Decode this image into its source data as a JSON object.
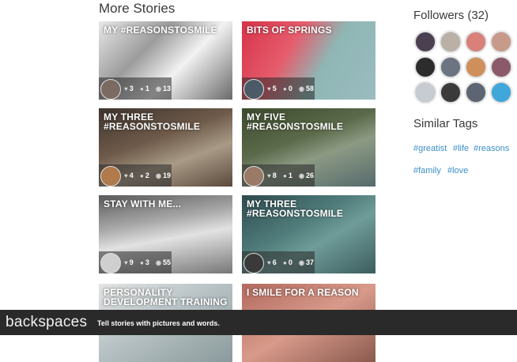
{
  "more_stories": {
    "title": "More Stories",
    "cards": [
      {
        "title": "MY #REASONSTOSMILE",
        "likes": "3",
        "comments": "1",
        "views": "13",
        "bg": "linear-gradient(135deg,#e8e8e8 0%,#9c9c9c 35%,#f2f2f2 60%,#6a6a6a 100%)",
        "avatar": "#7a6a62"
      },
      {
        "title": "BITS OF SPRINGS",
        "likes": "5",
        "comments": "0",
        "views": "58",
        "bg": "linear-gradient(120deg,#d6334a 0%,#e65c6c 35%,#8fb6b4 60%,#9bbcc0 100%)",
        "avatar": "#4b5a66"
      },
      {
        "title": "MY THREE #REASONSTOSMILE",
        "likes": "4",
        "comments": "2",
        "views": "19",
        "bg": "linear-gradient(160deg,#3e342e 0%,#6e5a4a 40%,#a89a86 65%,#5a4a3c 100%)",
        "avatar": "#b07a4a"
      },
      {
        "title": "MY FIVE #REASONSTOSMILE",
        "likes": "8",
        "comments": "1",
        "views": "26",
        "bg": "linear-gradient(160deg,#3c4a2e 0%,#5b6a4a 40%,#8c9a84 60%,#556a6c 100%)",
        "avatar": "#9a7a66"
      },
      {
        "title": "STAY WITH ME...",
        "likes": "9",
        "comments": "3",
        "views": "55",
        "bg": "linear-gradient(170deg,#5a5a5a 0%,#a8a8a8 35%,#e2e2e2 55%,#777777 100%)",
        "avatar": "#cfcfcf"
      },
      {
        "title": "MY THREE #REASONSTOSMILE",
        "likes": "6",
        "comments": "0",
        "views": "37",
        "bg": "linear-gradient(150deg,#2f4a4e 0%,#4f7c7a 40%,#6f9c98 60%,#3c5c5e 100%)",
        "avatar": "#3a3a3a"
      },
      {
        "title": "PERSONALITY DEVELOPMENT TRAINING",
        "likes": "",
        "comments": "",
        "views": "",
        "bg": "linear-gradient(150deg,#e4e4e4 0%,#bcc6c8 40%,#8a9a9c 100%)",
        "avatar": ""
      },
      {
        "title": "I SMILE FOR A REASON",
        "likes": "",
        "comments": "",
        "views": "",
        "bg": "linear-gradient(150deg,#b26a5e 0%,#d89a8a 50%,#8a5a4e 100%)",
        "avatar": ""
      }
    ]
  },
  "followers": {
    "title": "Followers (32)",
    "avatars": [
      "#4a4050",
      "#b9b0a6",
      "#d9807a",
      "#c79a8a",
      "#2c2c2c",
      "#6b7480",
      "#cf8f5a",
      "#8a5a6a",
      "#c6ccd2",
      "#3a3a3a",
      "#5d6572",
      "#3fa7d9"
    ]
  },
  "similar_tags": {
    "title": "Similar Tags",
    "tags": [
      "#greatist",
      "#life",
      "#reasons",
      "#family",
      "#love"
    ]
  },
  "footer": {
    "logo": "backspaces",
    "tagline": "Tell stories with pictures and words."
  }
}
